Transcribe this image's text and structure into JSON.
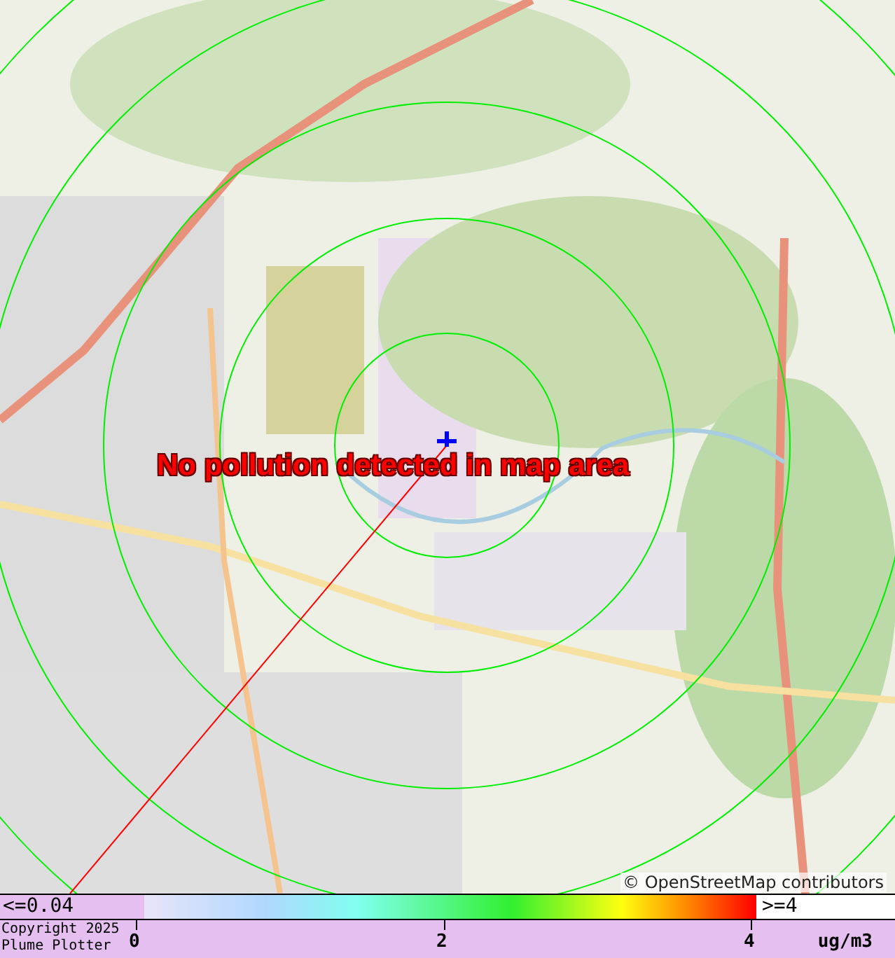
{
  "map": {
    "message": "No pollution detected in map area",
    "attribution": "© OpenStreetMap contributors"
  },
  "legend": {
    "min_label": "<=0.04",
    "max_label": ">=4",
    "ticks": [
      "0",
      "2",
      "4"
    ],
    "unit": "ug/m3",
    "copyright": [
      "Copyright 2025",
      "Plume Plotter"
    ]
  }
}
